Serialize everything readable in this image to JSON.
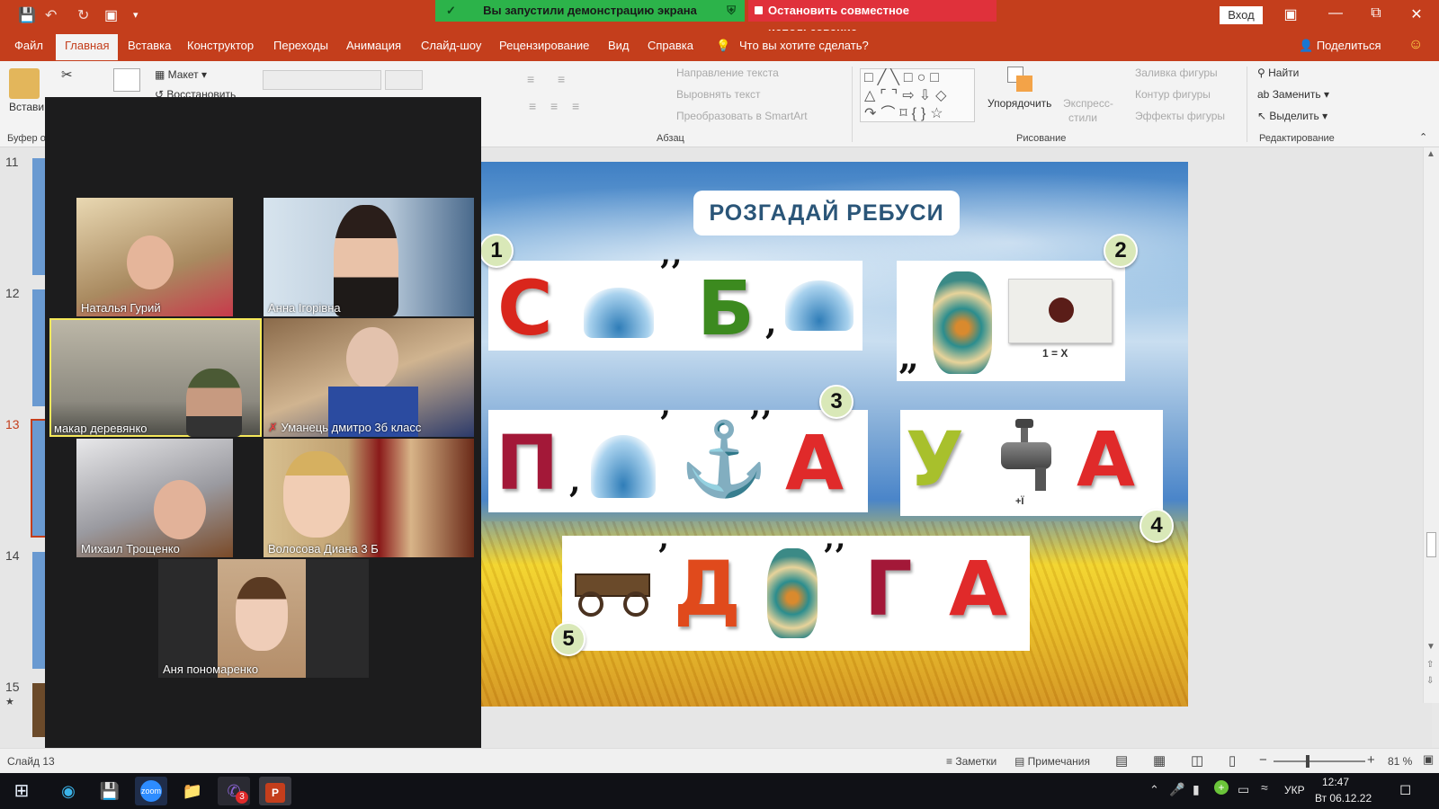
{
  "screen_share": {
    "status_text": "Вы запустили демонстрацию экрана",
    "stop_label": "Остановить совместное использование"
  },
  "titlebar": {
    "login_label": "Вход"
  },
  "ribbon_tabs": [
    "Файл",
    "Главная",
    "Вставка",
    "Конструктор",
    "Переходы",
    "Анимация",
    "Слайд-шоу",
    "Рецензирование",
    "Вид",
    "Справка"
  ],
  "tell_me": "Что вы хотите сделать?",
  "share_label": "Поделиться",
  "ribbon": {
    "paste": "Встави",
    "clipboard_group": "Буфер о",
    "layout": "Макет",
    "reset": "Восстановить",
    "text_direction": "Направление текста",
    "align_text": "Выровнять текст",
    "smartart": "Преобразовать в SmartArt",
    "paragraph_group": "Абзац",
    "arrange": "Упорядочить",
    "quick_styles_1": "Экспресс-",
    "quick_styles_2": "стили",
    "shape_fill": "Заливка фигуры",
    "shape_outline": "Контур фигуры",
    "shape_effects": "Эффекты фигуры",
    "drawing_group": "Рисование",
    "find": "Найти",
    "replace": "Заменить",
    "select": "Выделить",
    "editing_group": "Редактирование"
  },
  "slide_numbers": [
    "11",
    "12",
    "13",
    "14",
    "15"
  ],
  "current_slide": "13",
  "slide": {
    "title": "РОЗГАДАЙ РЕБУСИ",
    "badges": [
      "1",
      "2",
      "3",
      "4",
      "5"
    ],
    "r1": {
      "c": "С",
      "b": "Б"
    },
    "r2": {
      "note": "1 = Х"
    },
    "r3": {
      "p": "П",
      "a": "А"
    },
    "r4": {
      "u": "У",
      "a": "А",
      "note": "+Ї"
    },
    "r5": {
      "d": "Д",
      "g": "Г",
      "a": "А"
    }
  },
  "participants": [
    {
      "name": "Наталья Гурий"
    },
    {
      "name": "Анна Ігорівна"
    },
    {
      "name": "макар  деревянко"
    },
    {
      "name": "Уманець дмитро 3б класс"
    },
    {
      "name": "Михаил Трощенко"
    },
    {
      "name": "Волосова Диана 3 Б"
    },
    {
      "name": "Аня пономаренко"
    }
  ],
  "statusbar": {
    "slide_label": "Слайд 13",
    "notes": "Заметки",
    "comments": "Примечания",
    "zoom": "81 %"
  },
  "taskbar": {
    "language": "УКР",
    "time": "12:47",
    "date": "Вт 06.12.22",
    "viber_badge": "3"
  },
  "colors": {
    "ppt_accent": "#c43e1c",
    "share_green": "#2cb34a",
    "share_red": "#e0313b"
  }
}
